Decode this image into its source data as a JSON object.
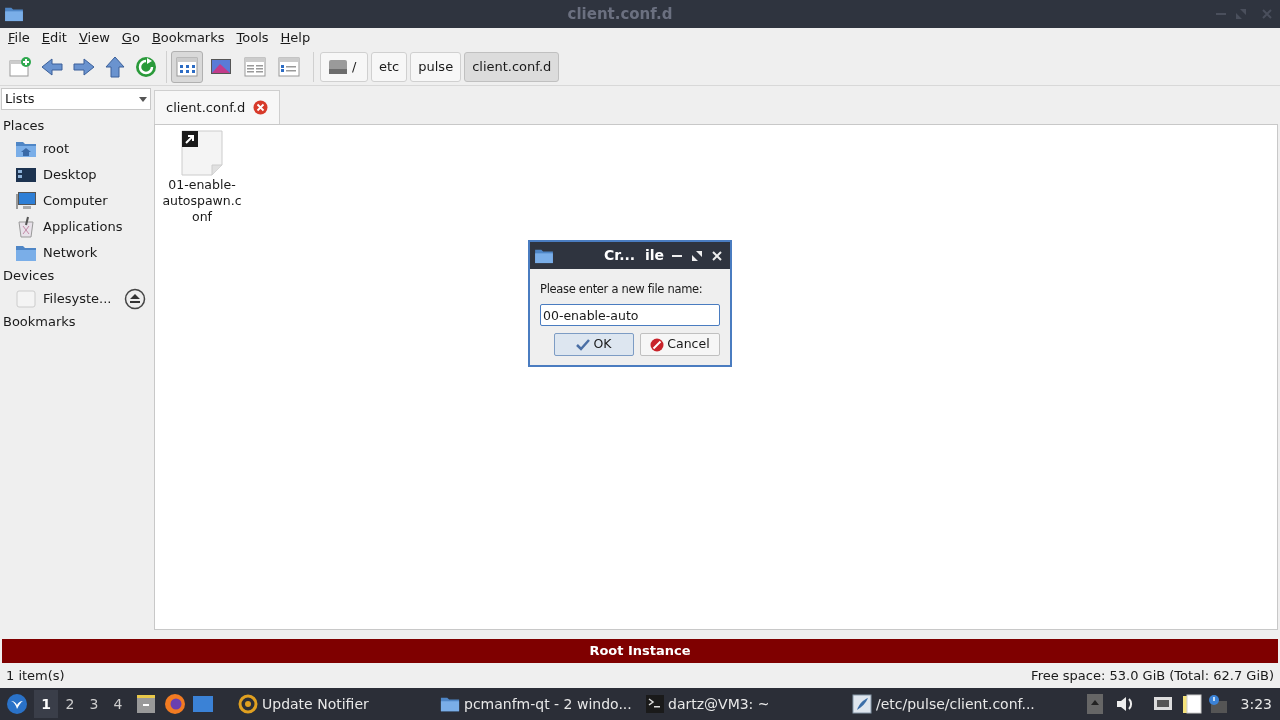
{
  "window": {
    "title": "client.conf.d"
  },
  "menu": [
    "File",
    "Edit",
    "View",
    "Go",
    "Bookmarks",
    "Tools",
    "Help"
  ],
  "view_modes": [
    {
      "selected": true
    },
    {
      "selected": false
    },
    {
      "selected": false
    },
    {
      "selected": false
    }
  ],
  "path": [
    {
      "label": "/",
      "kind": "drive",
      "selected": false
    },
    {
      "label": "etc",
      "kind": "dir",
      "selected": false
    },
    {
      "label": "pulse",
      "kind": "dir",
      "selected": false
    },
    {
      "label": "client.conf.d",
      "kind": "dir",
      "selected": true
    }
  ],
  "sidebar": {
    "mode": "Lists",
    "sections": [
      {
        "heading": "Places",
        "items": [
          {
            "label": "root",
            "kind": "home"
          },
          {
            "label": "Desktop",
            "kind": "desktop"
          },
          {
            "label": "Computer",
            "kind": "computer"
          },
          {
            "label": "Applications",
            "kind": "apps"
          },
          {
            "label": "Network",
            "kind": "network"
          }
        ]
      },
      {
        "heading": "Devices",
        "items": [
          {
            "label": "Filesyste...",
            "kind": "drive",
            "ejectable": true
          }
        ]
      },
      {
        "heading": "Bookmarks"
      }
    ]
  },
  "tabs": [
    {
      "label": "client.conf.d",
      "selected": true
    }
  ],
  "files": [
    {
      "name": "01-enable-autospawn.conf",
      "symlink": true
    }
  ],
  "banner": "Root Instance",
  "status_bar": {
    "left": "1 item(s)",
    "right": "Free space: 53.0 GiB (Total: 62.7 GiB)"
  },
  "dialog": {
    "title": "Cr...  ile",
    "prompt": "Please enter a new file name:",
    "value": "00-enable-auto",
    "buttons": [
      {
        "label": "OK",
        "kind": "ok"
      },
      {
        "label": "Cancel",
        "kind": "cancel"
      }
    ]
  },
  "taskbar": {
    "workspaces": [
      {
        "label": "1",
        "selected": true
      },
      {
        "label": "2",
        "selected": false
      },
      {
        "label": "3",
        "selected": false
      },
      {
        "label": "4",
        "selected": false
      }
    ],
    "tasks": [
      {
        "label": "Update Notifier",
        "kind": "update"
      },
      {
        "label": "pcmanfm-qt - 2 windo...",
        "kind": "folder"
      },
      {
        "label": "dartz@VM3: ~",
        "kind": "terminal"
      },
      {
        "label": "/etc/pulse/client.conf...",
        "kind": "editor"
      }
    ],
    "clock": "3:23"
  }
}
